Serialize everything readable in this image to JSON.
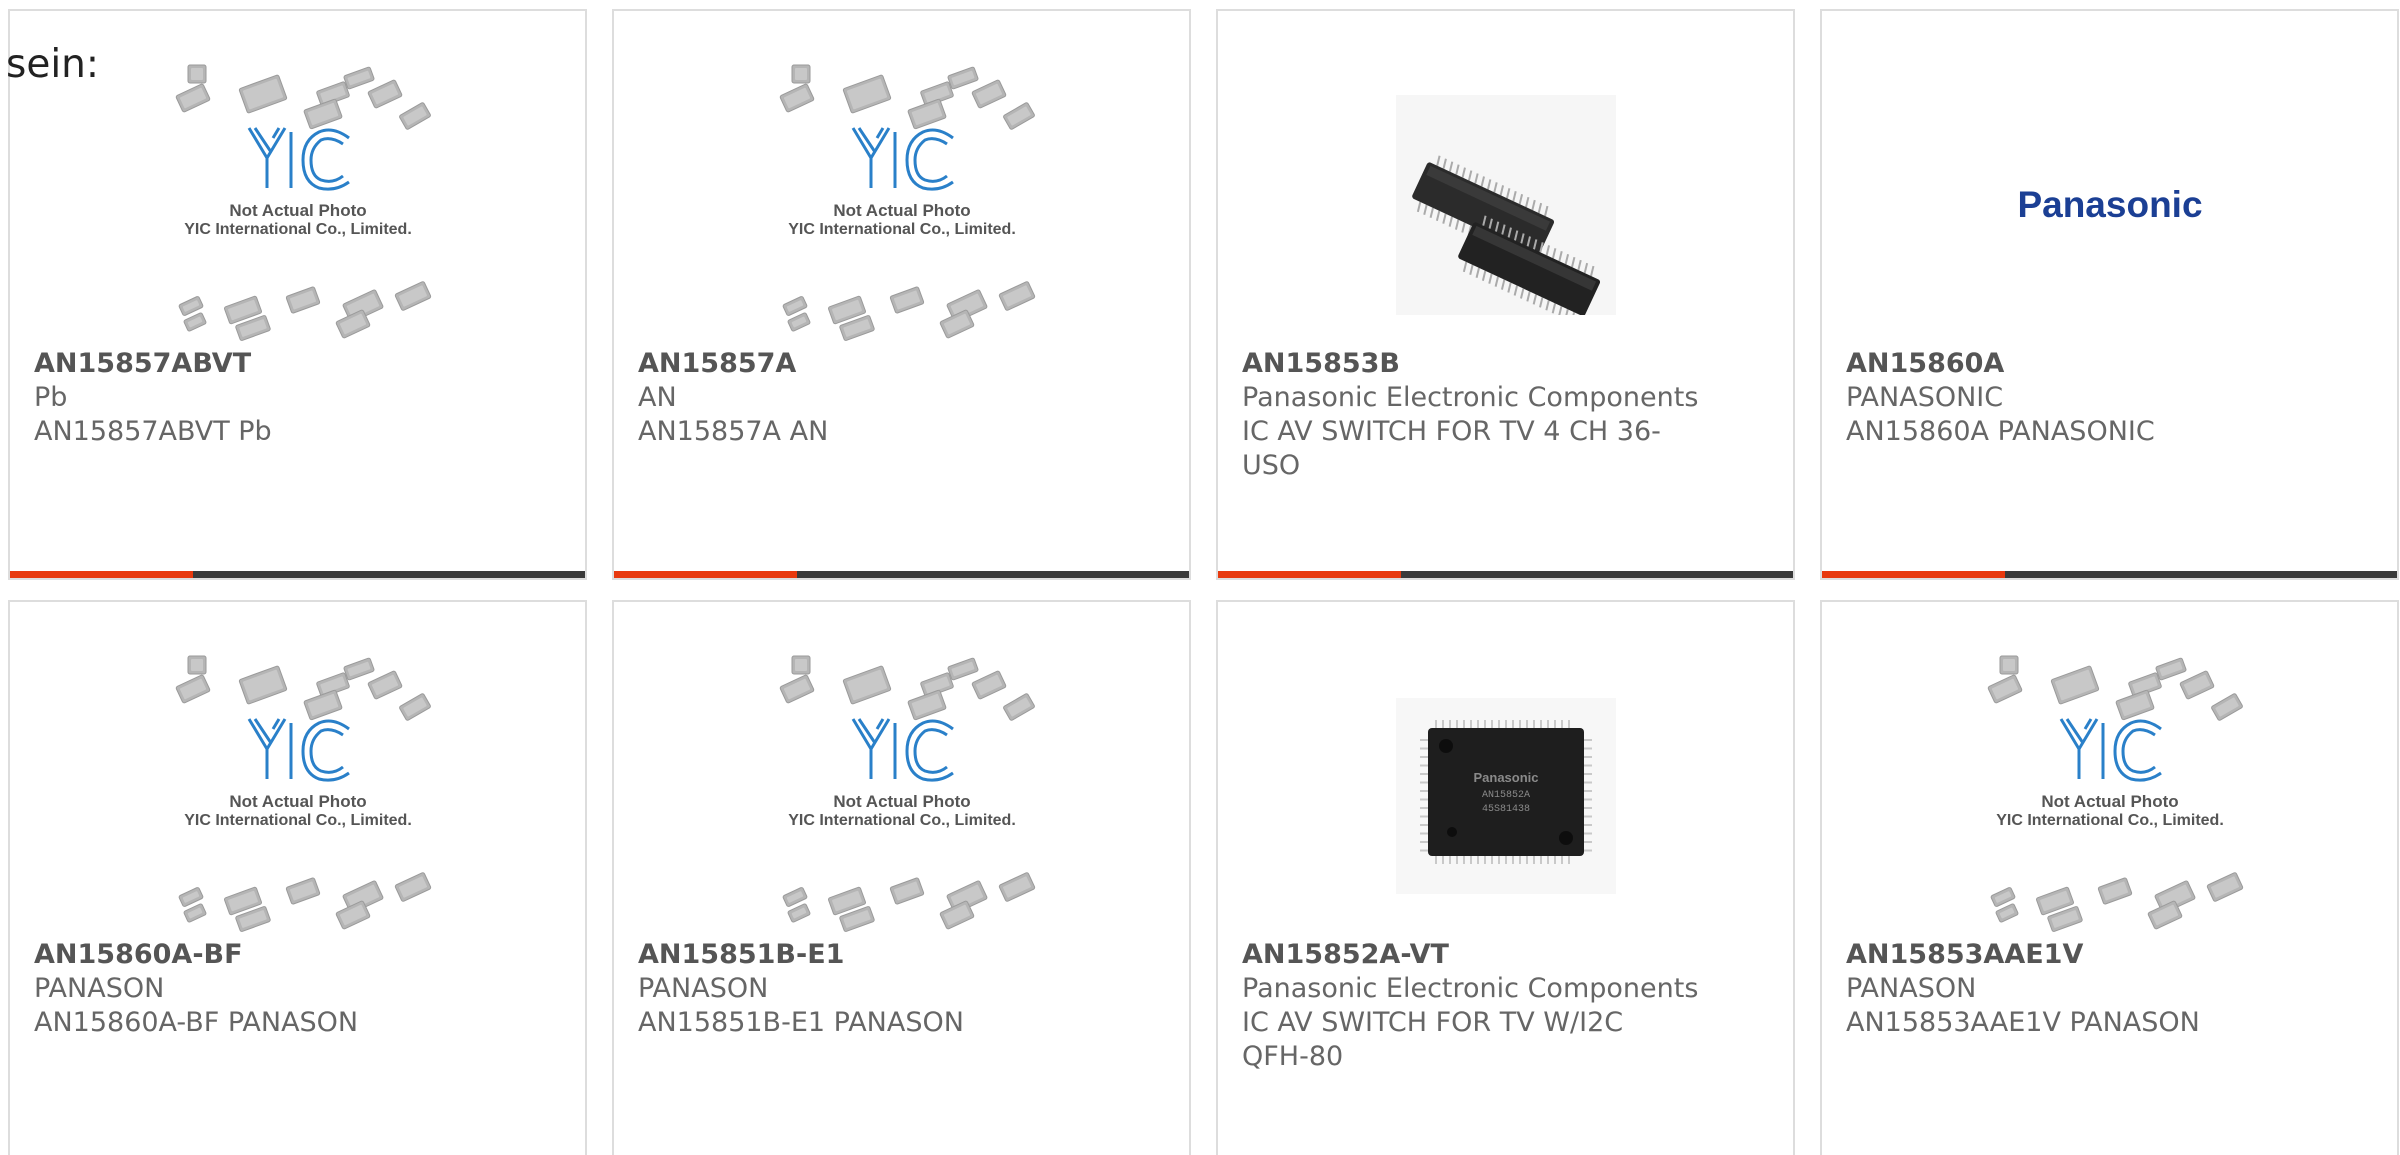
{
  "heading": "sein:",
  "placeholder": {
    "line1": "Not Actual Photo",
    "line2": "YIC International Co., Limited.",
    "logo": "YIC"
  },
  "panasonic_logo": "Panasonic",
  "chip_marking": [
    "Panasonic",
    "AN15852A",
    "45S81438"
  ],
  "colors": {
    "accent": "#e8390e",
    "bar": "#3a3a3a",
    "yic_blue": "#2a80c9",
    "panasonic_blue": "#1b3f94"
  },
  "products": [
    {
      "part": "AN15857ABVT",
      "maker": "Pb",
      "desc": "AN15857ABVT Pb",
      "image": "placeholder"
    },
    {
      "part": "AN15857A",
      "maker": "AN",
      "desc": "AN15857A AN",
      "image": "placeholder"
    },
    {
      "part": "AN15853B",
      "maker": "Panasonic Electronic Components",
      "desc": "IC AV SWITCH FOR TV 4 CH 36-USO",
      "image": "ssop-chip"
    },
    {
      "part": "AN15860A",
      "maker": "PANASONIC",
      "desc": "AN15860A PANASONIC",
      "image": "panasonic-logo"
    },
    {
      "part": "AN15860A-BF",
      "maker": "PANASON",
      "desc": "AN15860A-BF PANASON",
      "image": "placeholder"
    },
    {
      "part": "AN15851B-E1",
      "maker": "PANASON",
      "desc": "AN15851B-E1 PANASON",
      "image": "placeholder"
    },
    {
      "part": "AN15852A-VT",
      "maker": "Panasonic Electronic Components",
      "desc": "IC AV SWITCH FOR TV W/I2C QFH-80",
      "image": "qfp-chip"
    },
    {
      "part": "AN15853AAE1V",
      "maker": "PANASON",
      "desc": "AN15853AAE1V PANASON",
      "image": "placeholder"
    }
  ]
}
